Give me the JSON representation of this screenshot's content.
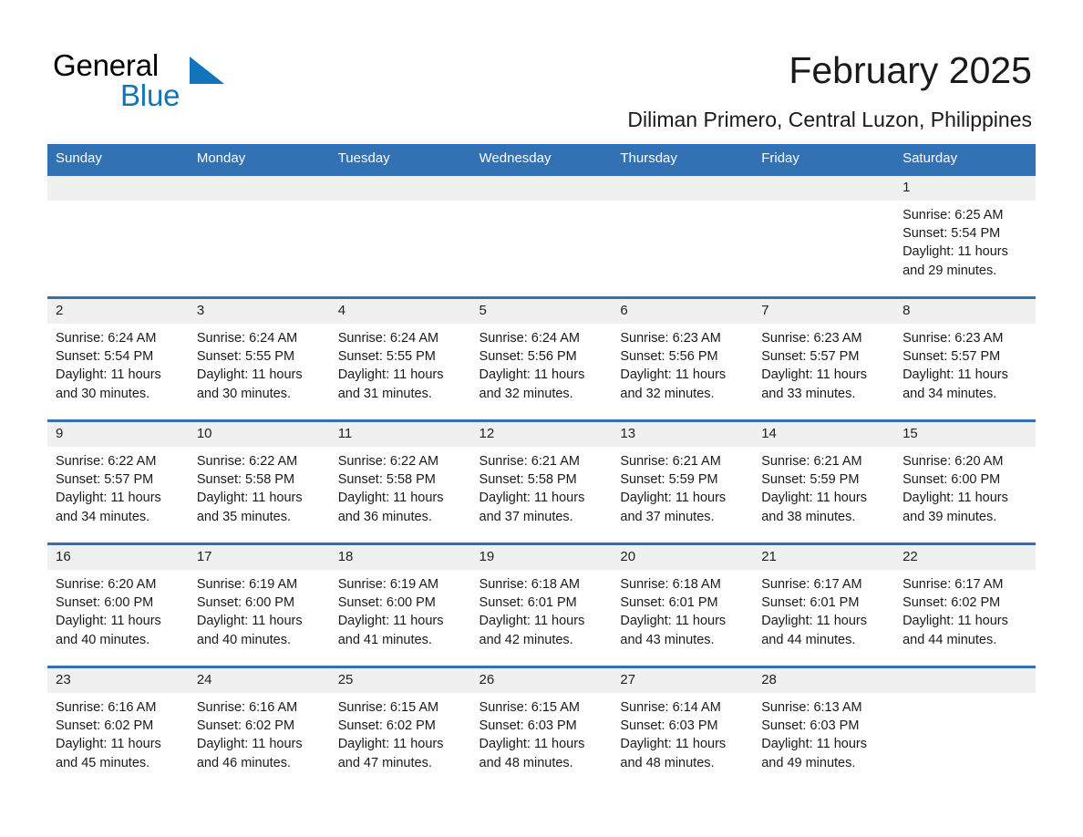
{
  "brand": {
    "name_dark": "General",
    "name_light": "Blue",
    "triangle_color": "#1275bc",
    "blue_color": "#1275bc"
  },
  "header": {
    "title": "February 2025",
    "subtitle": "Diliman Primero, Central Luzon, Philippines"
  },
  "theme": {
    "header_blue": "#3272b4",
    "day_strip_gray": "#f0f0f0",
    "text_dark": "#1a1a1a"
  },
  "weekdays": [
    "Sunday",
    "Monday",
    "Tuesday",
    "Wednesday",
    "Thursday",
    "Friday",
    "Saturday"
  ],
  "weeks": [
    [
      {
        "day": ""
      },
      {
        "day": ""
      },
      {
        "day": ""
      },
      {
        "day": ""
      },
      {
        "day": ""
      },
      {
        "day": ""
      },
      {
        "day": "1",
        "sunrise": "Sunrise: 6:25 AM",
        "sunset": "Sunset: 5:54 PM",
        "daylight": "Daylight: 11 hours and 29 minutes."
      }
    ],
    [
      {
        "day": "2",
        "sunrise": "Sunrise: 6:24 AM",
        "sunset": "Sunset: 5:54 PM",
        "daylight": "Daylight: 11 hours and 30 minutes."
      },
      {
        "day": "3",
        "sunrise": "Sunrise: 6:24 AM",
        "sunset": "Sunset: 5:55 PM",
        "daylight": "Daylight: 11 hours and 30 minutes."
      },
      {
        "day": "4",
        "sunrise": "Sunrise: 6:24 AM",
        "sunset": "Sunset: 5:55 PM",
        "daylight": "Daylight: 11 hours and 31 minutes."
      },
      {
        "day": "5",
        "sunrise": "Sunrise: 6:24 AM",
        "sunset": "Sunset: 5:56 PM",
        "daylight": "Daylight: 11 hours and 32 minutes."
      },
      {
        "day": "6",
        "sunrise": "Sunrise: 6:23 AM",
        "sunset": "Sunset: 5:56 PM",
        "daylight": "Daylight: 11 hours and 32 minutes."
      },
      {
        "day": "7",
        "sunrise": "Sunrise: 6:23 AM",
        "sunset": "Sunset: 5:57 PM",
        "daylight": "Daylight: 11 hours and 33 minutes."
      },
      {
        "day": "8",
        "sunrise": "Sunrise: 6:23 AM",
        "sunset": "Sunset: 5:57 PM",
        "daylight": "Daylight: 11 hours and 34 minutes."
      }
    ],
    [
      {
        "day": "9",
        "sunrise": "Sunrise: 6:22 AM",
        "sunset": "Sunset: 5:57 PM",
        "daylight": "Daylight: 11 hours and 34 minutes."
      },
      {
        "day": "10",
        "sunrise": "Sunrise: 6:22 AM",
        "sunset": "Sunset: 5:58 PM",
        "daylight": "Daylight: 11 hours and 35 minutes."
      },
      {
        "day": "11",
        "sunrise": "Sunrise: 6:22 AM",
        "sunset": "Sunset: 5:58 PM",
        "daylight": "Daylight: 11 hours and 36 minutes."
      },
      {
        "day": "12",
        "sunrise": "Sunrise: 6:21 AM",
        "sunset": "Sunset: 5:58 PM",
        "daylight": "Daylight: 11 hours and 37 minutes."
      },
      {
        "day": "13",
        "sunrise": "Sunrise: 6:21 AM",
        "sunset": "Sunset: 5:59 PM",
        "daylight": "Daylight: 11 hours and 37 minutes."
      },
      {
        "day": "14",
        "sunrise": "Sunrise: 6:21 AM",
        "sunset": "Sunset: 5:59 PM",
        "daylight": "Daylight: 11 hours and 38 minutes."
      },
      {
        "day": "15",
        "sunrise": "Sunrise: 6:20 AM",
        "sunset": "Sunset: 6:00 PM",
        "daylight": "Daylight: 11 hours and 39 minutes."
      }
    ],
    [
      {
        "day": "16",
        "sunrise": "Sunrise: 6:20 AM",
        "sunset": "Sunset: 6:00 PM",
        "daylight": "Daylight: 11 hours and 40 minutes."
      },
      {
        "day": "17",
        "sunrise": "Sunrise: 6:19 AM",
        "sunset": "Sunset: 6:00 PM",
        "daylight": "Daylight: 11 hours and 40 minutes."
      },
      {
        "day": "18",
        "sunrise": "Sunrise: 6:19 AM",
        "sunset": "Sunset: 6:00 PM",
        "daylight": "Daylight: 11 hours and 41 minutes."
      },
      {
        "day": "19",
        "sunrise": "Sunrise: 6:18 AM",
        "sunset": "Sunset: 6:01 PM",
        "daylight": "Daylight: 11 hours and 42 minutes."
      },
      {
        "day": "20",
        "sunrise": "Sunrise: 6:18 AM",
        "sunset": "Sunset: 6:01 PM",
        "daylight": "Daylight: 11 hours and 43 minutes."
      },
      {
        "day": "21",
        "sunrise": "Sunrise: 6:17 AM",
        "sunset": "Sunset: 6:01 PM",
        "daylight": "Daylight: 11 hours and 44 minutes."
      },
      {
        "day": "22",
        "sunrise": "Sunrise: 6:17 AM",
        "sunset": "Sunset: 6:02 PM",
        "daylight": "Daylight: 11 hours and 44 minutes."
      }
    ],
    [
      {
        "day": "23",
        "sunrise": "Sunrise: 6:16 AM",
        "sunset": "Sunset: 6:02 PM",
        "daylight": "Daylight: 11 hours and 45 minutes."
      },
      {
        "day": "24",
        "sunrise": "Sunrise: 6:16 AM",
        "sunset": "Sunset: 6:02 PM",
        "daylight": "Daylight: 11 hours and 46 minutes."
      },
      {
        "day": "25",
        "sunrise": "Sunrise: 6:15 AM",
        "sunset": "Sunset: 6:02 PM",
        "daylight": "Daylight: 11 hours and 47 minutes."
      },
      {
        "day": "26",
        "sunrise": "Sunrise: 6:15 AM",
        "sunset": "Sunset: 6:03 PM",
        "daylight": "Daylight: 11 hours and 48 minutes."
      },
      {
        "day": "27",
        "sunrise": "Sunrise: 6:14 AM",
        "sunset": "Sunset: 6:03 PM",
        "daylight": "Daylight: 11 hours and 48 minutes."
      },
      {
        "day": "28",
        "sunrise": "Sunrise: 6:13 AM",
        "sunset": "Sunset: 6:03 PM",
        "daylight": "Daylight: 11 hours and 49 minutes."
      },
      {
        "day": ""
      }
    ]
  ]
}
